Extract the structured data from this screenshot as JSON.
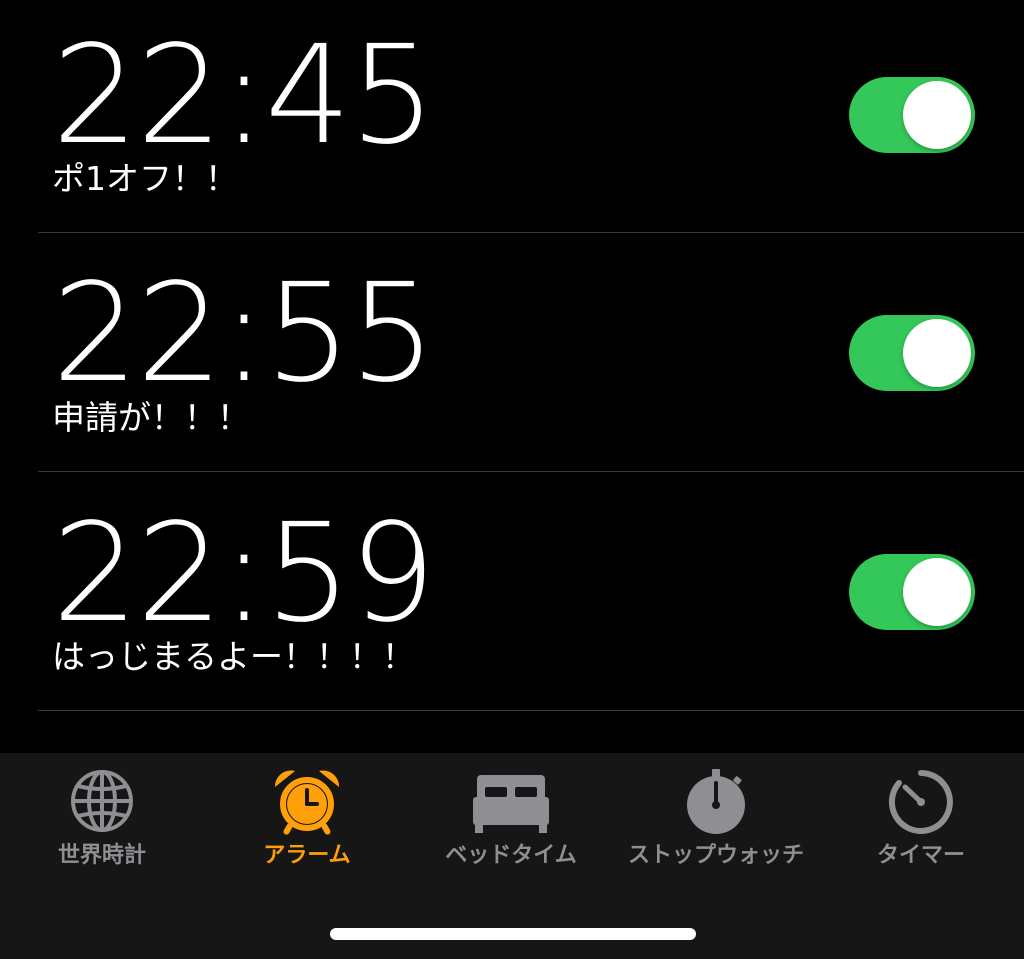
{
  "alarms": [
    {
      "time": "22:45",
      "label": "ポ1オフ！！",
      "enabled": true
    },
    {
      "time": "22:55",
      "label": "申請が！！！",
      "enabled": true
    },
    {
      "time": "22:59",
      "label": "はっじまるよー！！！！",
      "enabled": true
    }
  ],
  "tabbar": {
    "tabs": [
      {
        "label": "世界時計",
        "icon": "globe-icon",
        "active": false
      },
      {
        "label": "アラーム",
        "icon": "alarm-clock-icon",
        "active": true
      },
      {
        "label": "ベッドタイム",
        "icon": "bed-icon",
        "active": false
      },
      {
        "label": "ストップウォッチ",
        "icon": "stopwatch-icon",
        "active": false
      },
      {
        "label": "タイマー",
        "icon": "timer-icon",
        "active": false
      }
    ]
  },
  "colors": {
    "background": "#000000",
    "toggle_on": "#34c759",
    "tab_active": "#ff9f0a",
    "tab_inactive": "#8e8e93",
    "tabbar_background": "#161616"
  }
}
